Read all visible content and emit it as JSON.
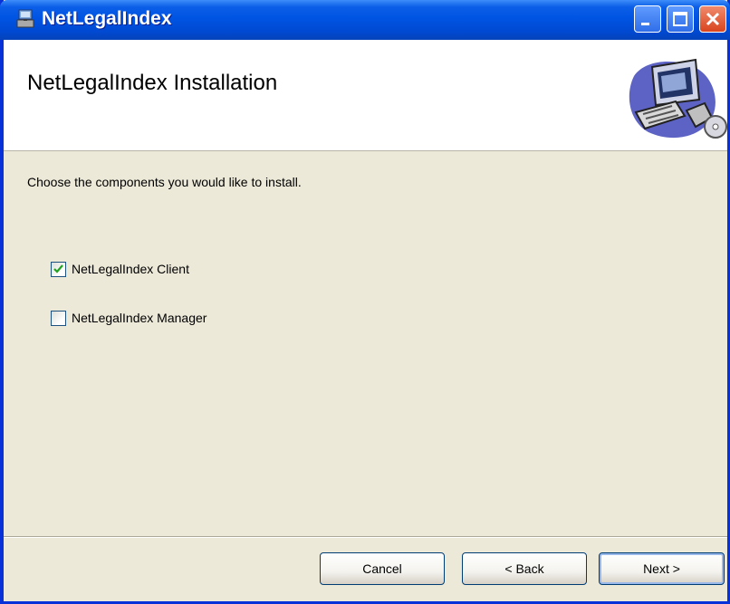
{
  "window": {
    "title": "NetLegalIndex"
  },
  "banner": {
    "title": "NetLegalIndex Installation"
  },
  "content": {
    "instruction": "Choose the components you would like to install.",
    "components": [
      {
        "label": "NetLegalIndex Client",
        "checked": true
      },
      {
        "label": "NetLegalIndex Manager",
        "checked": false
      }
    ]
  },
  "buttons": {
    "cancel": "Cancel",
    "back": "< Back",
    "next": "Next >"
  },
  "colors": {
    "titlebar": "#0054e3",
    "dialog_bg": "#ece9d8",
    "close_button": "#d8451e"
  }
}
